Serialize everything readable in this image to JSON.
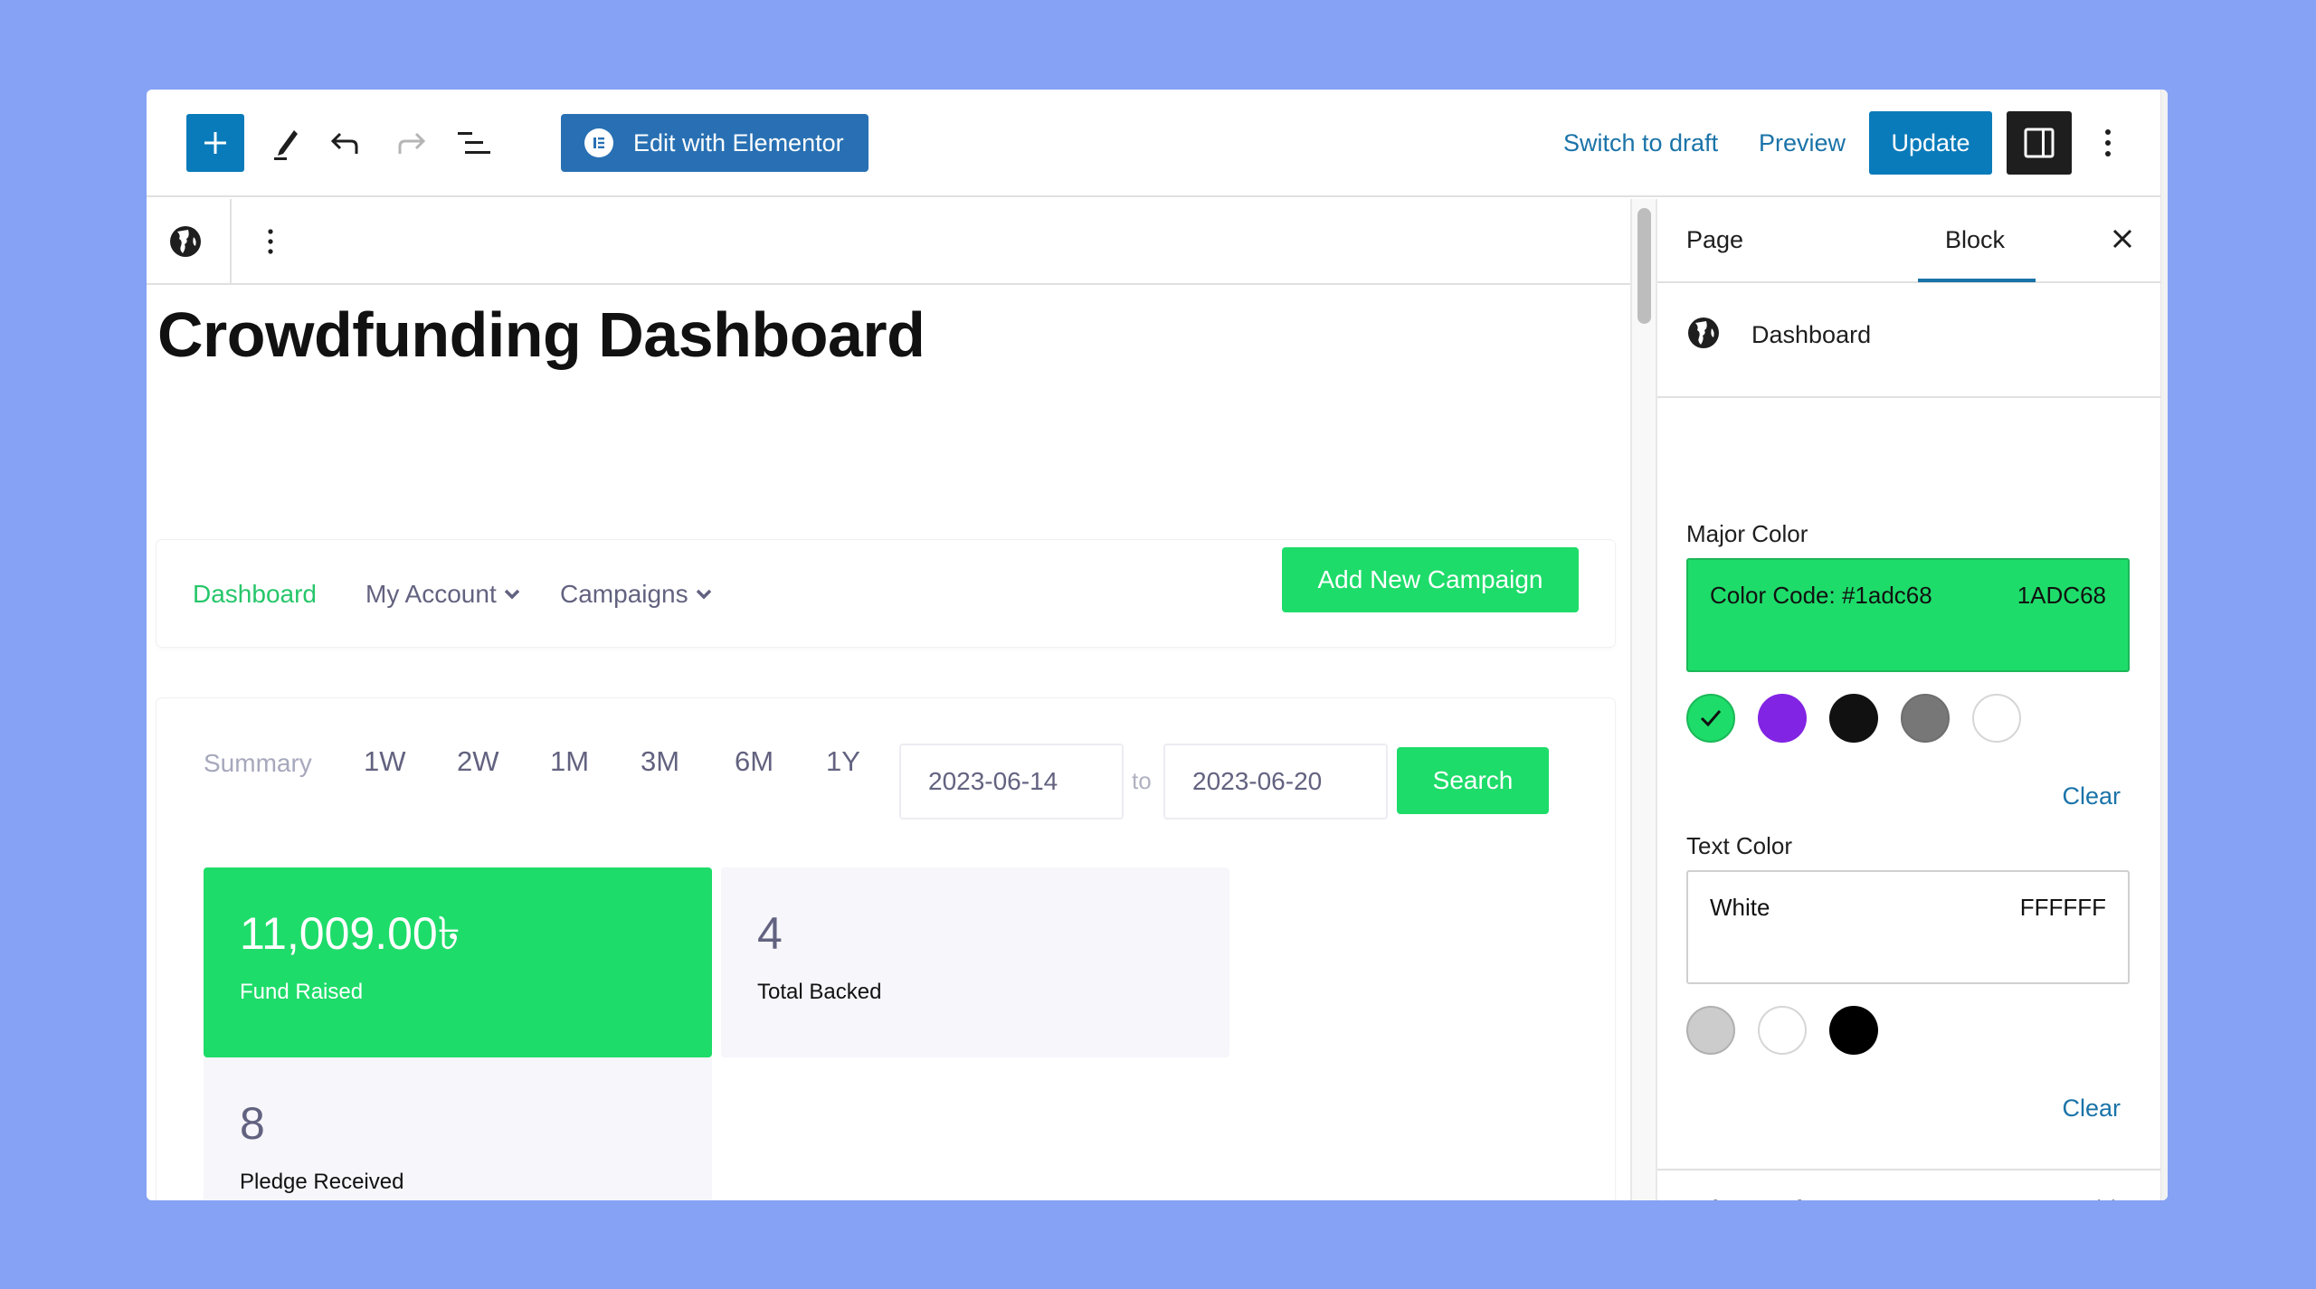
{
  "toolbar": {
    "add_block_icon": "plus-icon",
    "tools_icon": "pencil-icon",
    "undo_icon": "undo-icon",
    "redo_icon": "redo-icon",
    "list_view_icon": "list-view-icon",
    "elementor_label": "Edit with Elementor",
    "switch_to_draft_label": "Switch to draft",
    "preview_label": "Preview",
    "update_label": "Update",
    "settings_icon": "sidebar-toggle-icon",
    "options_icon": "kebab-icon"
  },
  "block_toolbar": {
    "block_icon": "globe-icon",
    "options_icon": "kebab-icon"
  },
  "page": {
    "title": "Crowdfunding Dashboard"
  },
  "dashboard_nav": {
    "items": [
      {
        "label": "Dashboard",
        "active": true,
        "dropdown": false
      },
      {
        "label": "My Account",
        "active": false,
        "dropdown": true
      },
      {
        "label": "Campaigns",
        "active": false,
        "dropdown": true
      }
    ],
    "add_campaign_label": "Add New Campaign"
  },
  "summary": {
    "label": "Summary",
    "ranges": [
      "1W",
      "2W",
      "1M",
      "3M",
      "6M",
      "1Y"
    ],
    "from_date": "2023-06-14",
    "to_label": "to",
    "to_date": "2023-06-20",
    "search_label": "Search"
  },
  "stats": [
    {
      "value": "11,009.00৳",
      "label": "Fund Raised",
      "highlight": true
    },
    {
      "value": "4",
      "label": "Total Backed",
      "highlight": false
    },
    {
      "value": "8",
      "label": "Pledge Received",
      "highlight": false
    }
  ],
  "sidebar": {
    "tabs": [
      {
        "label": "Page",
        "active": false
      },
      {
        "label": "Block",
        "active": true
      }
    ],
    "close_icon": "close-icon",
    "block_name": "Dashboard",
    "major_color": {
      "label": "Major Color",
      "name": "Color Code: #1adc68",
      "hex": "1ADC68",
      "value": "#1adc68",
      "swatches": [
        "#1adc68",
        "#8224e3",
        "#111111",
        "#777777",
        "#ffffff"
      ],
      "selected_index": 0,
      "clear_label": "Clear"
    },
    "text_color": {
      "label": "Text Color",
      "name": "White",
      "hex": "FFFFFF",
      "value": "#ffffff",
      "swatches": [
        "#cccccc",
        "#ffffff",
        "#000000"
      ],
      "clear_label": "Clear"
    },
    "advanced_label": "Advanced"
  },
  "colors": {
    "background": "#86a2f5",
    "wp_blue": "#0a7bba",
    "elementor_blue": "#2870b3",
    "accent_green": "#1edc6a",
    "nav_text": "#626280"
  }
}
